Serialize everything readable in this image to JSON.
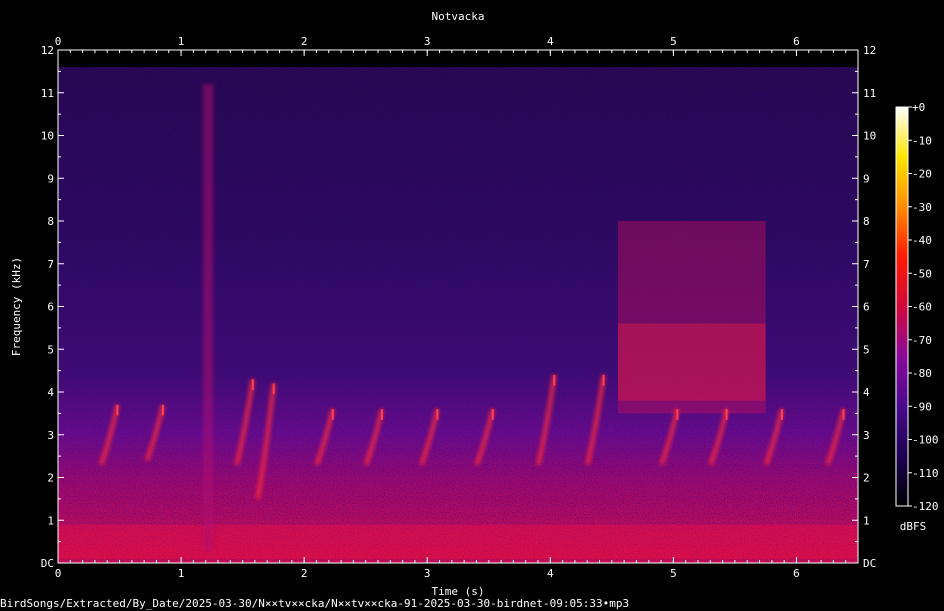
{
  "chart_data": {
    "type": "heatmap",
    "title": "Notvacka",
    "xlabel": "Time (s)",
    "ylabel": "Frequency (kHz)",
    "xlim": [
      0,
      6.5
    ],
    "ylim": [
      0,
      12
    ],
    "x_ticks": [
      0,
      1,
      2,
      3,
      4,
      5,
      6
    ],
    "y_ticks": [
      {
        "value": 0,
        "label": "DC"
      },
      {
        "value": 1,
        "label": "1"
      },
      {
        "value": 2,
        "label": "2"
      },
      {
        "value": 3,
        "label": "3"
      },
      {
        "value": 4,
        "label": "4"
      },
      {
        "value": 5,
        "label": "5"
      },
      {
        "value": 6,
        "label": "6"
      },
      {
        "value": 7,
        "label": "7"
      },
      {
        "value": 8,
        "label": "8"
      },
      {
        "value": 9,
        "label": "9"
      },
      {
        "value": 10,
        "label": "10"
      },
      {
        "value": 11,
        "label": "11"
      },
      {
        "value": 12,
        "label": "12"
      }
    ],
    "colorbar": {
      "unit": "dBFS",
      "range": [
        -120,
        0
      ],
      "ticks": [
        {
          "value": 0,
          "label": "+0"
        },
        {
          "value": -10,
          "label": "-10"
        },
        {
          "value": -20,
          "label": "-20"
        },
        {
          "value": -30,
          "label": "-30"
        },
        {
          "value": -40,
          "label": "-40"
        },
        {
          "value": -50,
          "label": "-50"
        },
        {
          "value": -60,
          "label": "-60"
        },
        {
          "value": -70,
          "label": "-70"
        },
        {
          "value": -80,
          "label": "-80"
        },
        {
          "value": -90,
          "label": "-90"
        },
        {
          "value": -100,
          "label": "-100"
        },
        {
          "value": -110,
          "label": "-110"
        },
        {
          "value": -120,
          "label": "-120"
        }
      ],
      "colors": [
        "#000000",
        "#1a0050",
        "#4a0a8c",
        "#8a0a9a",
        "#d0083a",
        "#ff1a00",
        "#ff8c00",
        "#ffe600",
        "#ffffff"
      ]
    },
    "background_colors": {
      "high_freq": "#2a0a5c",
      "low_freq": "#d4104a"
    },
    "events": [
      {
        "t": 0.45,
        "f_low": 2.3,
        "f_high": 3.7
      },
      {
        "t": 0.82,
        "f_low": 2.4,
        "f_high": 3.7
      },
      {
        "t": 1.22,
        "f_low": 0.3,
        "f_high": 11.2
      },
      {
        "t": 1.55,
        "f_low": 2.3,
        "f_high": 4.3
      },
      {
        "t": 1.72,
        "f_low": 1.5,
        "f_high": 4.2
      },
      {
        "t": 2.2,
        "f_low": 2.3,
        "f_high": 3.6
      },
      {
        "t": 2.6,
        "f_low": 2.3,
        "f_high": 3.6
      },
      {
        "t": 3.05,
        "f_low": 2.3,
        "f_high": 3.6
      },
      {
        "t": 3.5,
        "f_low": 2.3,
        "f_high": 3.6
      },
      {
        "t": 4.0,
        "f_low": 2.3,
        "f_high": 4.4
      },
      {
        "t": 4.4,
        "f_low": 2.3,
        "f_high": 4.4
      },
      {
        "t": 5.0,
        "f_low": 2.3,
        "f_high": 3.6
      },
      {
        "t": 5.4,
        "f_low": 2.3,
        "f_high": 3.6
      },
      {
        "t": 5.85,
        "f_low": 2.3,
        "f_high": 3.6
      },
      {
        "t": 6.35,
        "f_low": 2.3,
        "f_high": 3.6
      }
    ],
    "dense_region": {
      "t0": 4.55,
      "t1": 5.75,
      "f0": 3.5,
      "f1": 8.0
    }
  },
  "file_path": "BirdSongs/Extracted/By_Date/2025-03-30/N××tv××cka/N××tv××cka-91-2025-03-30-birdnet-09:05:33•mp3"
}
